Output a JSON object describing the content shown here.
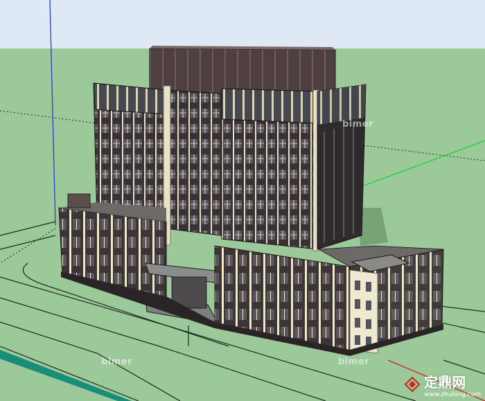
{
  "scene": {
    "sky_color": "#dfe8f5",
    "ground_color": "#9cc99a",
    "facade_dark": "#3a3134",
    "facade_light": "#e8e3c8",
    "glass_color": "#57555e",
    "roof_color": "#5a4747",
    "axis_blue": "#2a3bd6",
    "axis_green": "#1bd13a",
    "axis_red": "#d02020"
  },
  "watermarks": {
    "wm1": "bimer",
    "wm2": "bimer",
    "wm3": "bimer"
  },
  "logo": {
    "icon_name": "diamond-logo-icon",
    "text": "定鼎网",
    "url": "www.zhulong.com"
  }
}
